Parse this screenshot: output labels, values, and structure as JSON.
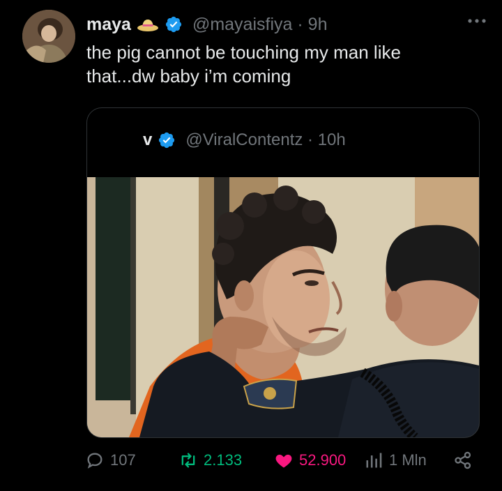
{
  "tweet": {
    "author_name": "maya",
    "author_handle": "@mayaisfiya",
    "time": "9h",
    "separator": "·",
    "text_line1": "the pig cannot be touching my man like",
    "text_line2": "that...dw baby i’m coming",
    "name_emoji_icon": "straw-hat-icon",
    "verified_icon": "verified-badge-icon",
    "more_icon": "more-options-icon"
  },
  "quoted": {
    "author_name": "v",
    "author_handle": "@ViralContentz",
    "time": "10h",
    "separator": "·",
    "image": "photo of a man in orange being held by a police officer"
  },
  "actions": {
    "replies": "107",
    "retweets": "2.133",
    "likes": "52.900",
    "views": "1 Mln"
  },
  "colors": {
    "background": "#000000",
    "text": "#e7e9ea",
    "muted": "#71767b",
    "verified": "#1d9bf0",
    "retweet": "#00ba7c",
    "like": "#f91880"
  }
}
